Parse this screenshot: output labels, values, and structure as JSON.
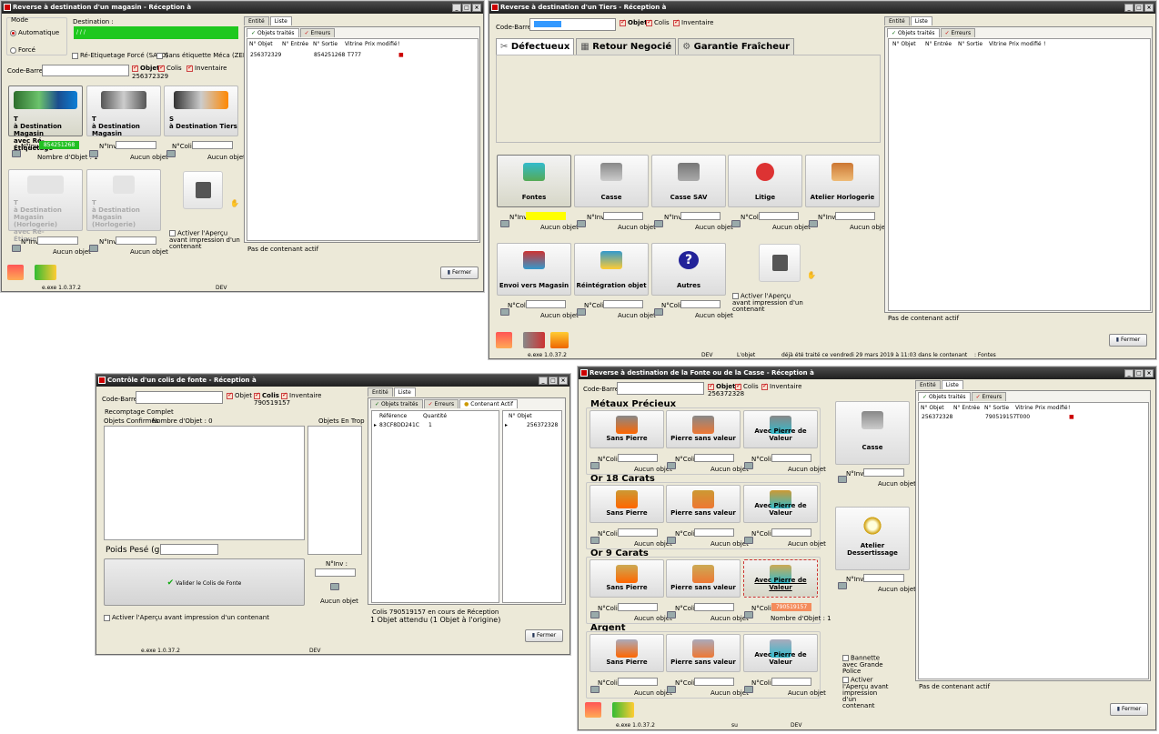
{
  "w1": {
    "title": "Reverse à destination d'un magasin - Réception à",
    "mode_label": "Mode",
    "mode_auto": "Automatique",
    "mode_force": "Forcé",
    "destination_label": "Destination :",
    "destination_value": "/ / /",
    "reetiq_label": "Ré-Etiquetage Forcé (SATO)",
    "sans_etiq_label": "Sans étiquette Méca (ZEBRA)",
    "codebarres_label": "Code-Barres :",
    "objet": "Objet",
    "objet_num": "256372329",
    "colis": "Colis",
    "inventaire": "Inventaire",
    "btn1_line1": "T",
    "btn1_line2": "à Destination Magasin",
    "btn1_line3": "avec Ré-Étiquetage",
    "btn2_line1": "T",
    "btn2_line2": "à Destination Magasin",
    "btn3_line1": "S",
    "btn3_line2": "à Destination Tiers",
    "btn4_line1": "T",
    "btn4_line2": "à Destination Magasin",
    "btn4_line3": "(Horlogerie)",
    "btn4_line4": "avec Ré-Étiquetage",
    "btn5_line1": "T",
    "btn5_line2": "à Destination Magasin",
    "btn5_line3": "(Horlogerie)",
    "ninv": "N°Inv :",
    "ncolis": "N°Colis :",
    "ninv_val": "854251268",
    "nb_objet": "Nombre d'Objet : 1",
    "aucun": "Aucun objet",
    "apercu": "Activer l'Aperçu avant impression d'un contenant",
    "tab_entite": "Entité",
    "tab_liste": "Liste",
    "sub_traites": "Objets traités",
    "sub_erreurs": "Erreurs",
    "col_objet": "N° Objet",
    "col_entree": "N° Entrée",
    "col_sortie": "N° Sortie",
    "col_vitrine": "Vitrine",
    "col_prix": "Prix modifié",
    "row_objet": "256372329",
    "row_sortie": "854251268",
    "row_vitrine": "T777",
    "pas_contenant": "Pas de contenant actif",
    "fermer": "Fermer",
    "version": "e.exe 1.0.37.2",
    "dev": "DEV"
  },
  "w2": {
    "title": "Reverse à destination d'un Tiers - Réception à",
    "codebarres_label": "Code-Barres :",
    "objet": "Objet",
    "colis": "Colis",
    "inventaire": "Inventaire",
    "tab_defectueux": "Défectueux",
    "tab_retour": "Retour Negocié",
    "tab_garantie": "Garantie Fraîcheur",
    "btn_fontes": "Fontes",
    "btn_casse": "Casse",
    "btn_casse_sav": "Casse SAV",
    "btn_litige": "Litige",
    "btn_atelier": "Atelier Horlogerie",
    "btn_envoi": "Envoi vers Magasin",
    "btn_reint": "Réintégration objet",
    "btn_autres": "Autres",
    "ninv": "N°Inv :",
    "ncolis": "N°Colis :",
    "aucun": "Aucun objet",
    "apercu": "Activer l'Aperçu avant impression d'un contenant",
    "tab_entite": "Entité",
    "tab_liste": "Liste",
    "sub_traites": "Objets traités",
    "sub_erreurs": "Erreurs",
    "col_objet": "N° Objet",
    "col_entree": "N° Entrée",
    "col_sortie": "N° Sortie",
    "col_vitrine": "Vitrine",
    "col_prix": "Prix modifié",
    "pas_contenant": "Pas de contenant actif",
    "fermer": "Fermer",
    "version": "e.exe 1.0.37.2",
    "dev": "DEV",
    "status_objet": "L'objet",
    "status_msg": "déjà été traité ce vendredi 29 mars 2019 à 11:03 dans le contenant",
    "status_fontes": ": Fontes"
  },
  "w3": {
    "title": "Contrôle d'un colis de fonte - Réception à",
    "codebarres_label": "Code-Barres :",
    "objet": "Objet",
    "colis": "Colis",
    "colis_num": "790519157",
    "inventaire": "Inventaire",
    "recomptage": "Recomptage Complet",
    "objets_confirmes": "Objets Confirmés",
    "nombre_objet": "Nombre d'Objet : 0",
    "objets_en_trop": "Objets En Trop",
    "poids": "Poids Pesé (g) :",
    "valider": "Valider le Colis de Fonte",
    "ninv": "N°Inv :",
    "aucun": "Aucun objet",
    "apercu": "Activer l'Aperçu avant impression d'un contenant",
    "tab_entite": "Entité",
    "tab_liste": "Liste",
    "sub_traites": "Objets traités",
    "sub_erreurs": "Erreurs",
    "sub_contenant": "Contenant Actif",
    "col_ref": "Référence",
    "col_qte": "Quantité",
    "col_nobjet": "N° Objet",
    "row_ref": "83CF8DD241C",
    "row_qte": "1",
    "row_nobjet": "256372328",
    "colis_status": "Colis 790519157 en cours de Réception",
    "attendu": "1 Objet attendu (1 Objet à l'origine)",
    "fermer": "Fermer",
    "version": "e.exe 1.0.37.2",
    "dev": "DEV"
  },
  "w4": {
    "title": "Reverse à destination de la Fonte ou de la Casse - Réception à",
    "codebarres_label": "Code-Barres :",
    "objet": "Objet",
    "objet_num": "256372328",
    "colis": "Colis",
    "inventaire": "Inventaire",
    "sec1": "Métaux Précieux",
    "sec2": "Or 18 Carats",
    "sec3": "Or 9 Carats",
    "sec4": "Argent",
    "sans_pierre": "Sans Pierre",
    "pierre_sans": "Pierre sans valeur",
    "avec_pierre": "Avec Pierre de Valeur",
    "casse": "Casse",
    "atelier": "Atelier Dessertissage",
    "ncolis": "N°Colis :",
    "ninv": "N°Inv :",
    "aucun": "Aucun objet",
    "colis_val": "790519157",
    "nb_objet": "Nombre d'Objet : 1",
    "bannette": "Bannette avec Grande Police",
    "apercu": "Activer l'Aperçu avant impression d'un contenant",
    "tab_entite": "Entité",
    "tab_liste": "Liste",
    "sub_traites": "Objets traités",
    "sub_erreurs": "Erreurs",
    "col_objet": "N° Objet",
    "col_entree": "N° Entrée",
    "col_sortie": "N° Sortie",
    "col_vitrine": "Vitrine",
    "col_prix": "Prix modifié",
    "row_objet": "256372328",
    "row_sortie": "790519157",
    "row_vitrine": "T000",
    "pas_contenant": "Pas de contenant actif",
    "fermer": "Fermer",
    "version": "e.exe 1.0.37.2",
    "su": "su",
    "dev": "DEV"
  }
}
